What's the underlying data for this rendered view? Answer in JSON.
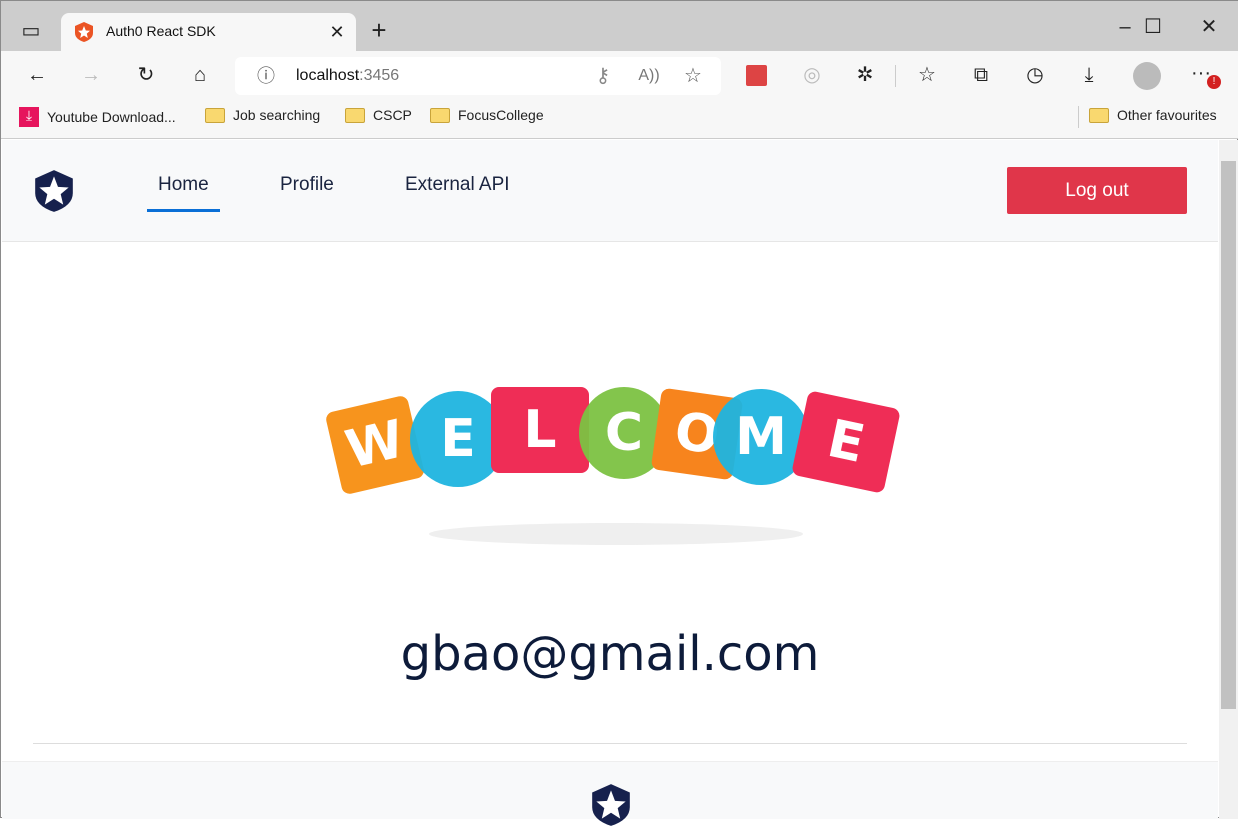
{
  "browser": {
    "tab_title": "Auth0 React SDK",
    "url_host": "localhost",
    "url_port": ":3456",
    "bookmarks": [
      "Youtube Download...",
      "Job searching",
      "CSCP",
      "FocusCollege"
    ],
    "other_favourites": "Other favourites",
    "notification_badge": "!"
  },
  "nav": {
    "links": [
      "Home",
      "Profile",
      "External API"
    ],
    "active": "Home",
    "logout_label": "Log out"
  },
  "main": {
    "welcome_letters": [
      "W",
      "E",
      "L",
      "C",
      "O",
      "M",
      "E"
    ],
    "email": "gbao@gmail.com"
  },
  "colors": {
    "logout": "#e0364a",
    "active_underline": "#0a6fd6",
    "text": "#0d1b3a"
  }
}
